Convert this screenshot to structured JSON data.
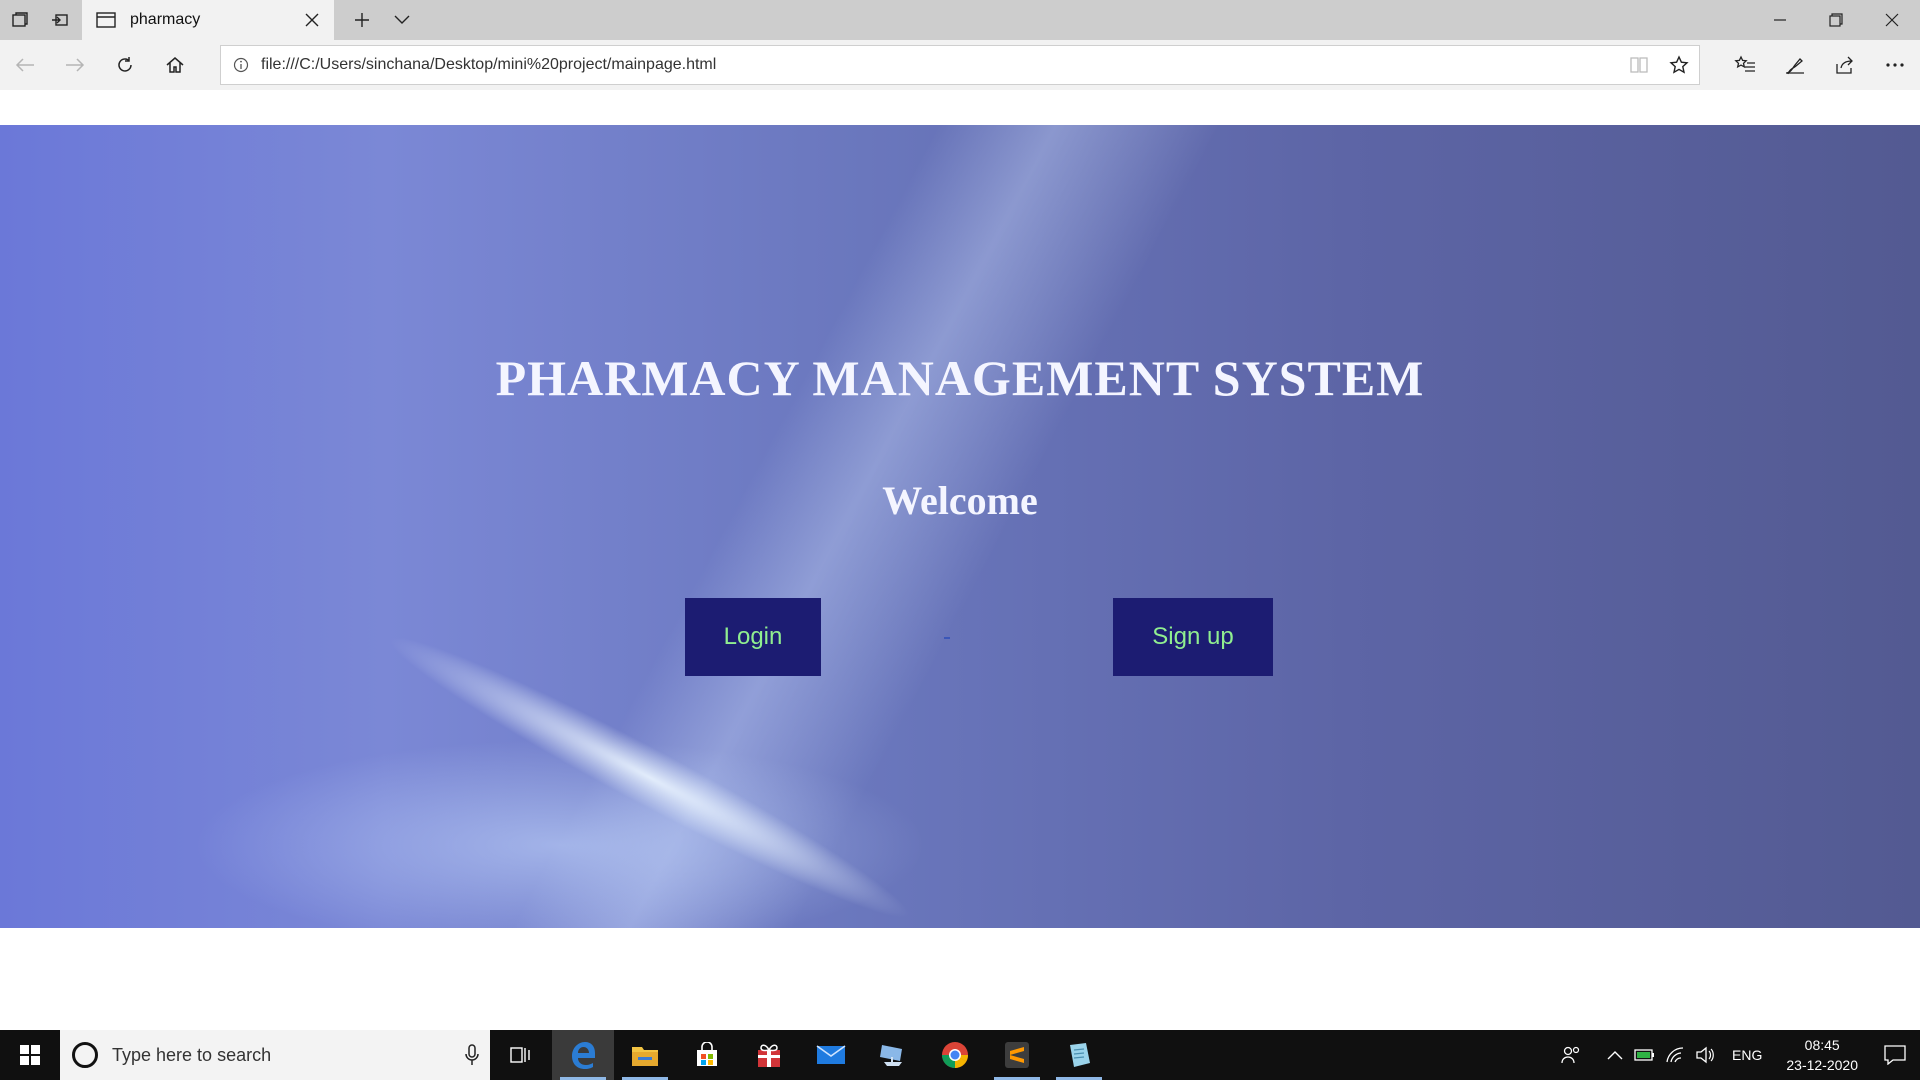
{
  "browser": {
    "tab_title": "pharmacy",
    "url": "file:///C:/Users/sinchana/Desktop/mini%20project/mainpage.html"
  },
  "page": {
    "title": "PHARMACY MANAGEMENT SYSTEM",
    "welcome": "Welcome",
    "login_label": "Login",
    "signup_label": "Sign up",
    "colors": {
      "button_bg": "#1c1c72",
      "button_text": "#90ee90",
      "heading_text": "#f4f5ff"
    }
  },
  "taskbar": {
    "search_placeholder": "Type here to search",
    "apps": [
      "task-view-icon",
      "edge-icon",
      "file-explorer-icon",
      "store-icon",
      "gift-icon",
      "mail-icon",
      "network-pc-icon",
      "chrome-icon",
      "sublime-text-icon",
      "notepad-icon"
    ],
    "language": "ENG",
    "time": "08:45",
    "date": "23-12-2020"
  }
}
